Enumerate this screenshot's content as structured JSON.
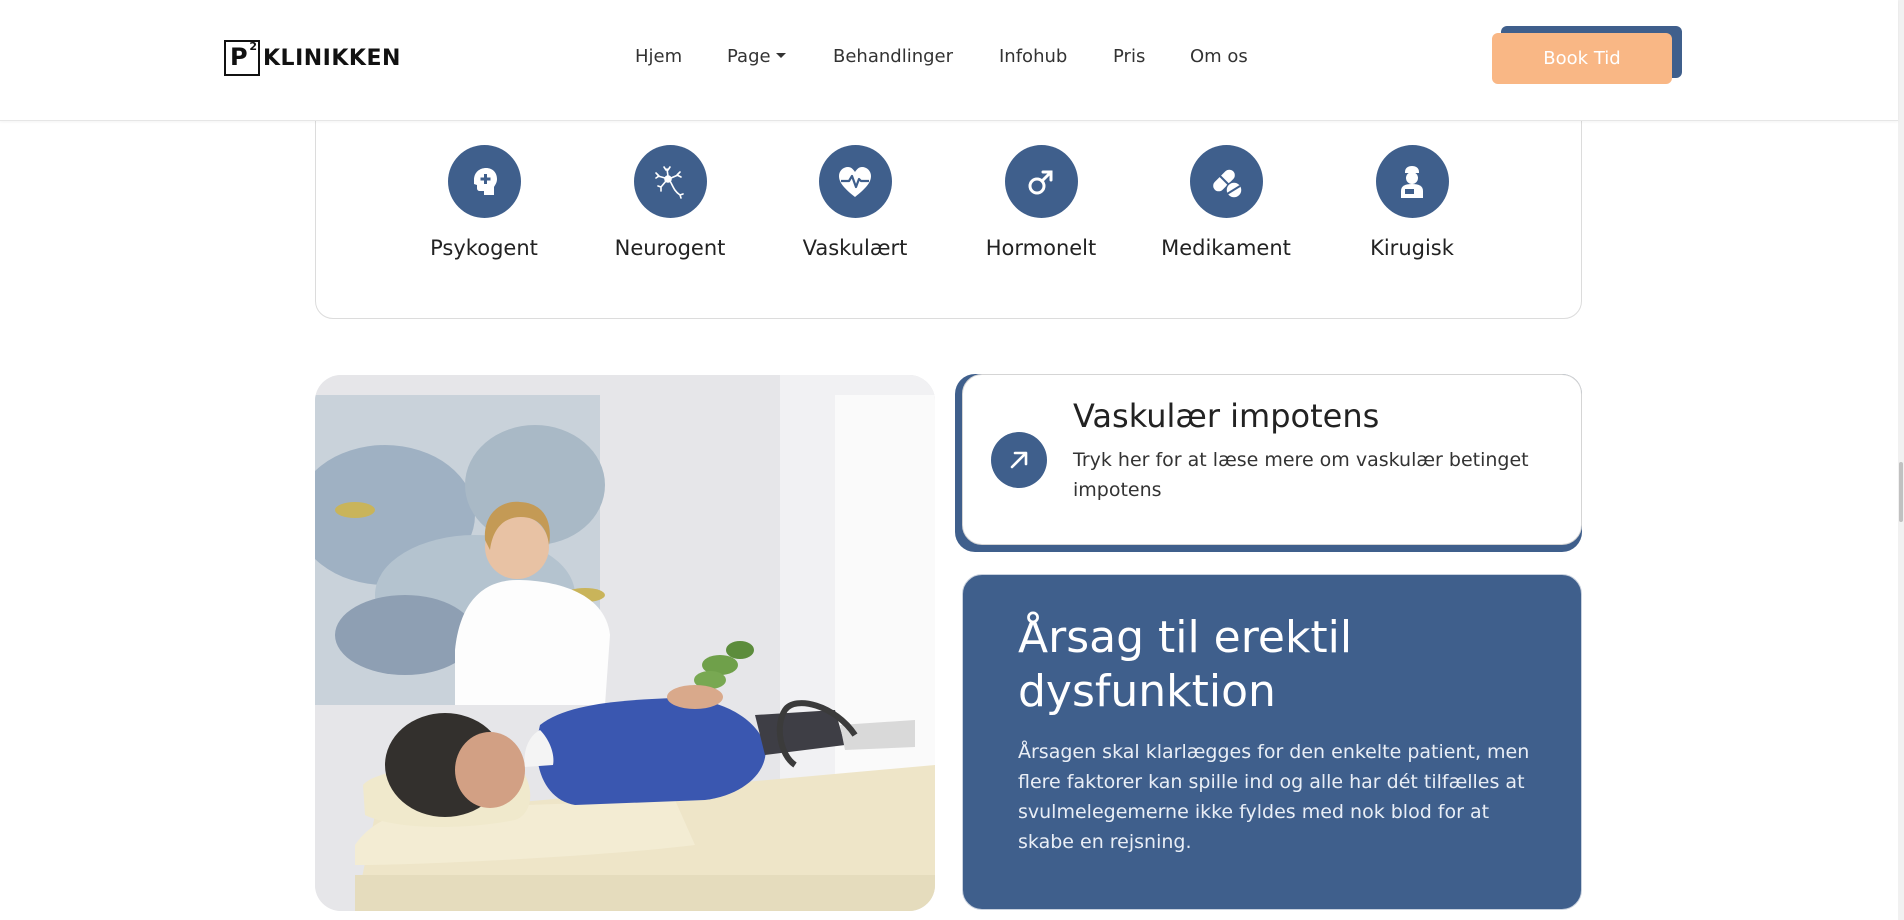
{
  "header": {
    "logo_mark": "P",
    "logo_sup": "2",
    "logo_text": "KLINIKKEN",
    "nav": [
      "Hjem",
      "Page",
      "Behandlinger",
      "Infohub",
      "Pris",
      "Om os"
    ],
    "book_label": "Book Tid"
  },
  "categories": [
    {
      "label": "Psykogent",
      "icon": "head-plus-icon"
    },
    {
      "label": "Neurogent",
      "icon": "neuron-icon"
    },
    {
      "label": "Vaskulært",
      "icon": "heart-pulse-icon"
    },
    {
      "label": "Hormonelt",
      "icon": "male-symbol-icon"
    },
    {
      "label": "Medikament",
      "icon": "pills-icon"
    },
    {
      "label": "Kirugisk",
      "icon": "surgeon-icon"
    }
  ],
  "vaskular": {
    "title": "Vaskulær impotens",
    "text": "Tryk her for at læse mere om vaskulær betinget impotens"
  },
  "aarsag": {
    "title": "Årsag til erektil dysfunktion",
    "text": "Årsagen skal klarlægges for den enkelte patient, men flere faktorer kan spille ind og alle har dét tilfælles at svulmelegemerne ikke fyldes med nok blod for at skabe en rejsning."
  },
  "colors": {
    "primary": "#3f5f8c",
    "accent": "#f9b785"
  }
}
